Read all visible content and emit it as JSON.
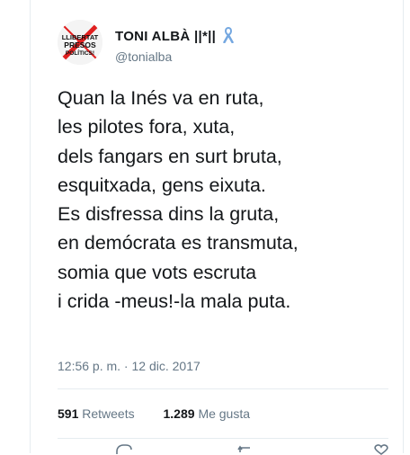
{
  "user": {
    "display_name": "TONI ALBÀ ||*||",
    "handle": "@tonialba",
    "avatar_text": [
      "LLIBERTAT",
      "PRESOS",
      "POLÍTICS!"
    ],
    "ribbon_icon": "yellow-ribbon-icon",
    "ribbon_color": "#74a7e0"
  },
  "tweet": {
    "lines": [
      "Quan la Inés va en ruta,",
      "les pilotes fora, xuta,",
      "dels fangars en surt bruta,",
      "esquitxada, gens eixuta.",
      "Es disfressa dins la gruta,",
      "en demócrata es transmuta,",
      "somia que vots escruta",
      "i crida -meus!-la mala puta."
    ],
    "timestamp": "12:56 p. m. · 12 dic. 2017"
  },
  "stats": {
    "retweets_count": "591",
    "retweets_label": "Retweets",
    "likes_count": "1.289",
    "likes_label": "Me gusta"
  },
  "actions": [
    "reply-icon",
    "retweet-icon",
    "like-icon"
  ]
}
